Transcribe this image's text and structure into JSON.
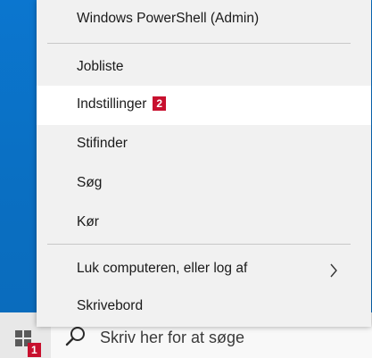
{
  "menu": {
    "items": [
      {
        "label": "Windows PowerShell (Admin)"
      },
      {
        "label": "Jobliste"
      },
      {
        "label": "Indstillinger",
        "badge": "2",
        "highlighted": true
      },
      {
        "label": "Stifinder"
      },
      {
        "label": "Søg"
      },
      {
        "label": "Kør"
      },
      {
        "label": "Luk computeren, eller log af",
        "has_submenu": true
      },
      {
        "label": "Skrivebord"
      }
    ]
  },
  "taskbar": {
    "start_badge": "1",
    "search_placeholder": "Skriv her for at søge"
  },
  "colors": {
    "desktop": "#0a72c6",
    "menu_bg": "#f1f1f1",
    "highlight": "#ffffff",
    "badge": "#c8102e"
  },
  "icons": [
    "windows-logo-icon",
    "search-icon",
    "chevron-right-icon"
  ]
}
